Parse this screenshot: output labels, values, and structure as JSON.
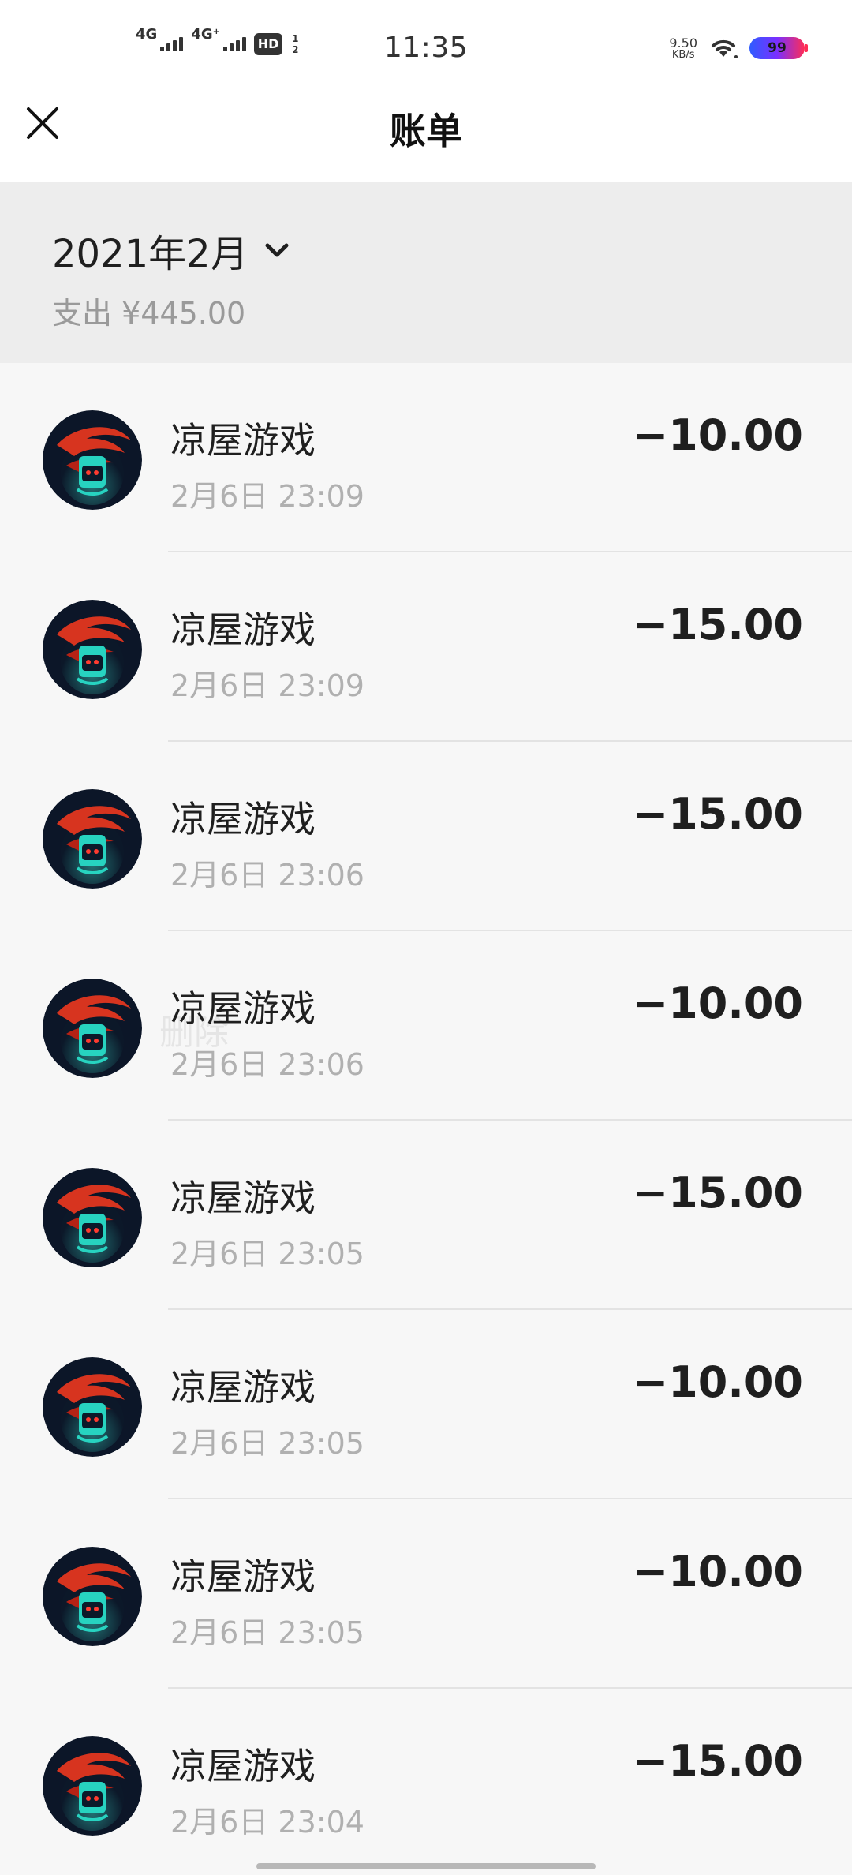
{
  "status_bar": {
    "time": "11:35",
    "sim1_label": "4G",
    "sim2_label": "4G⁺",
    "hd_label": "HD",
    "hd_sub_top": "1",
    "hd_sub_bottom": "2",
    "speed_value": "9.50",
    "speed_unit": "KB/s",
    "battery": "99",
    "icons": [
      "signal-icon",
      "wifi-icon",
      "battery-icon"
    ]
  },
  "header": {
    "title": "账单",
    "close_icon": "close-icon"
  },
  "month": {
    "label": "2021年2月",
    "expense": "支出 ¥445.00",
    "dropdown_icon": "chevron-down-icon"
  },
  "ghost_text": "删除",
  "transactions": [
    {
      "merchant": "凉屋游戏",
      "time": "2月6日 23:09",
      "amount": "−10.00"
    },
    {
      "merchant": "凉屋游戏",
      "time": "2月6日 23:09",
      "amount": "−15.00"
    },
    {
      "merchant": "凉屋游戏",
      "time": "2月6日 23:06",
      "amount": "−15.00"
    },
    {
      "merchant": "凉屋游戏",
      "time": "2月6日 23:06",
      "amount": "−10.00"
    },
    {
      "merchant": "凉屋游戏",
      "time": "2月6日 23:05",
      "amount": "−15.00"
    },
    {
      "merchant": "凉屋游戏",
      "time": "2月6日 23:05",
      "amount": "−10.00"
    },
    {
      "merchant": "凉屋游戏",
      "time": "2月6日 23:05",
      "amount": "−10.00"
    },
    {
      "merchant": "凉屋游戏",
      "time": "2月6日 23:04",
      "amount": "−15.00"
    }
  ],
  "colors": {
    "background": "#f7f7f7",
    "month_bar": "#ededed",
    "text_primary": "#1f1f1f",
    "text_secondary": "#b0b0b0",
    "divider": "#e3e3e3"
  }
}
